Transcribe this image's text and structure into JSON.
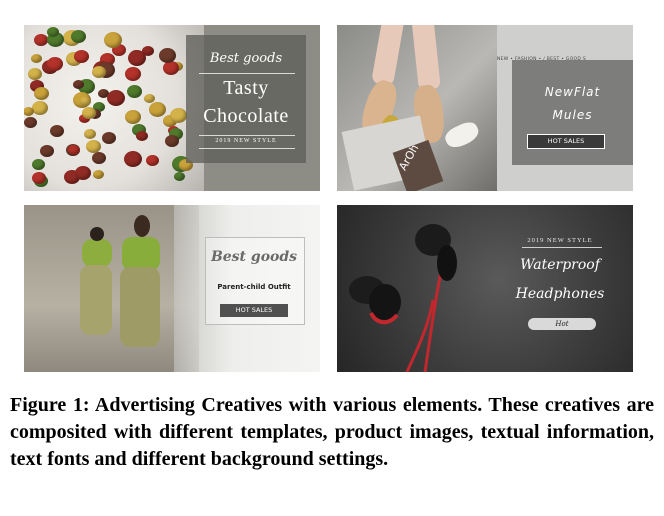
{
  "panels": {
    "chocolate": {
      "script": "Best goods",
      "line1": "Tasty",
      "line2": "Chocolate",
      "small": "2019 NEW STYLE"
    },
    "mules": {
      "tagline": "NEW • FASHION • / BEST • GOOD S",
      "line1": "NewFlat",
      "line2": "Mules",
      "button": "HOT SALES",
      "book_text": "ArOh"
    },
    "outfit": {
      "title": "Best goods",
      "subtitle": "Parent-child Outfit",
      "button": "HOT SALES"
    },
    "headphones": {
      "small": "2019 NEW STYLE",
      "line1": "Waterproof",
      "line2": "Headphones",
      "button": "Hot"
    }
  },
  "caption": "Figure 1: Advertising Creatives with various elements. These creatives are composited with different templates, product images, textual information, text fonts and different background settings.",
  "colors": {
    "candy": [
      "#b3322a",
      "#4f7a2c",
      "#c9a23a",
      "#6b3a2a",
      "#d4b24a",
      "#8f2a24"
    ]
  }
}
